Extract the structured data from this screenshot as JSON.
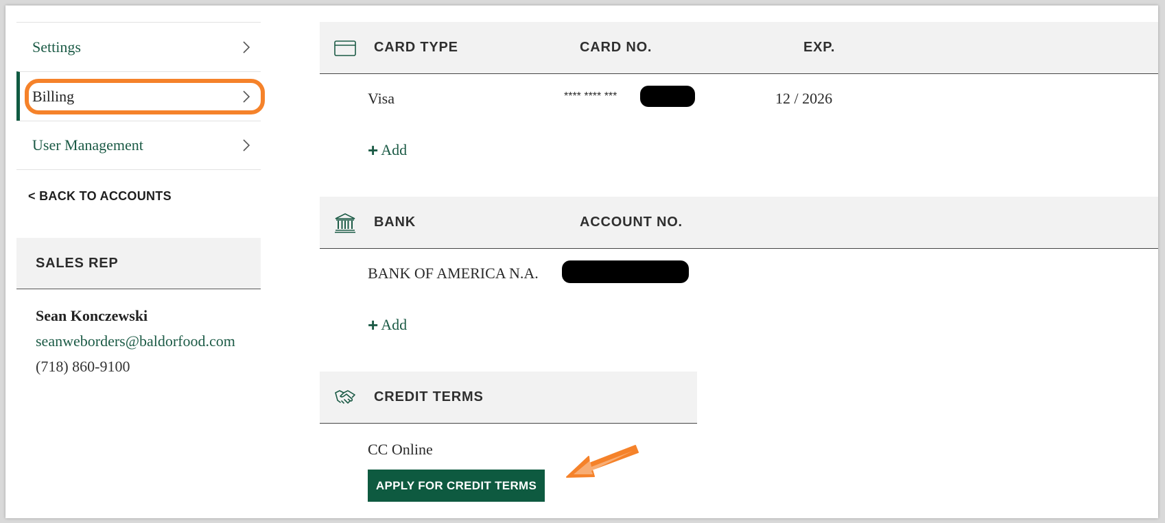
{
  "sidebar": {
    "items": [
      {
        "label": "Settings"
      },
      {
        "label": "Billing"
      },
      {
        "label": "User Management"
      }
    ],
    "back_label": "< BACK TO ACCOUNTS"
  },
  "sales_rep": {
    "heading": "SALES REP",
    "name": "Sean Konczewski",
    "email": "seanweborders@baldorfood.com",
    "phone": "(718) 860-9100"
  },
  "cards": {
    "headers": {
      "type": "CARD TYPE",
      "number": "CARD NO.",
      "exp": "EXP."
    },
    "rows": [
      {
        "type": "Visa",
        "number": "**** **** ***",
        "exp": "12 / 2026"
      }
    ],
    "add_label": "Add"
  },
  "bank": {
    "headers": {
      "bank": "BANK",
      "account": "ACCOUNT NO."
    },
    "rows": [
      {
        "bank": "BANK OF AMERICA N.A."
      }
    ],
    "add_label": "Add"
  },
  "credit": {
    "heading": "CREDIT TERMS",
    "value": "CC Online",
    "apply_label": "APPLY FOR CREDIT TERMS"
  },
  "colors": {
    "brand_green": "#0e5a40",
    "link_green": "#1b5a45",
    "annotation_orange": "#f5822a",
    "header_bg": "#f2f2f2"
  },
  "icons": [
    "chevron-right-icon",
    "credit-card-icon",
    "bank-icon",
    "handshake-icon",
    "plus-icon",
    "annotation-arrow-icon"
  ]
}
